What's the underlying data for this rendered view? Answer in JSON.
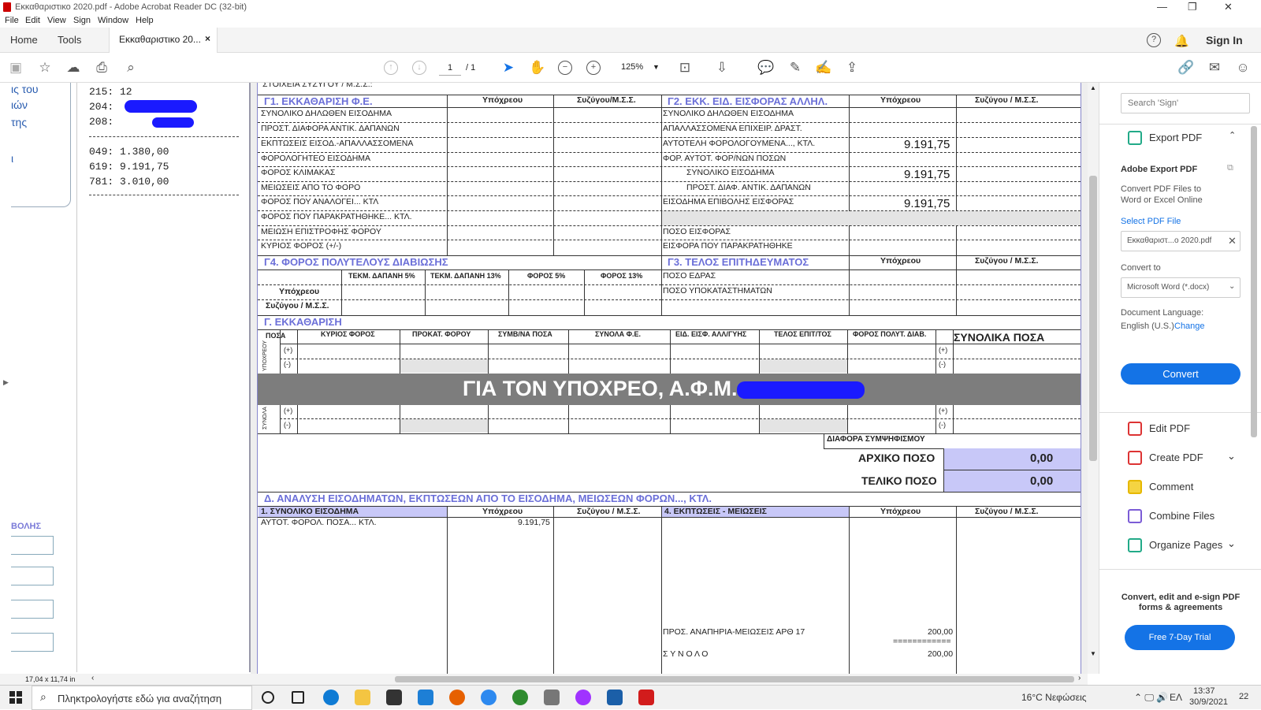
{
  "window": {
    "title": "Εκκαθαριστικο 2020.pdf - Adobe Acrobat Reader DC (32-bit)"
  },
  "menu": [
    "File",
    "Edit",
    "View",
    "Sign",
    "Window",
    "Help"
  ],
  "tabs": {
    "home": "Home",
    "tools": "Tools",
    "doc": "Εκκαθαριστικο 20...",
    "close": "×",
    "signin": "Sign In"
  },
  "toolbar": {
    "page_current": "1",
    "page_total": "/ 1",
    "zoom": "125%"
  },
  "left_panel": {
    "blue_fragments": [
      "ις του",
      "ιών",
      "της",
      "ι",
      "ΒΟΛΗΣ"
    ],
    "lines_top": [
      "215: 12",
      "204:",
      "208:"
    ],
    "lines_bottom": [
      "049:  1.380,00",
      "619:  9.191,75",
      "781:  3.010,00"
    ]
  },
  "doc": {
    "top_fragment": "ΣΤΟΙΧΕΙΑ ΣΥΖΥΓΟΥ / Μ.Σ.Σ.:",
    "g1": {
      "title": "Γ1. ΕΚΚΑΘΑΡΙΣΗ Φ.Ε.",
      "col1": "Υπόχρεου",
      "col2": "Συζύγου/Μ.Σ.Σ.",
      "rows": [
        "ΣΥΝΟΛΙΚΟ ΔΗΛΩΘΕΝ ΕΙΣΟΔΗΜΑ",
        "ΠΡΟΣΤ. ΔΙΑΦΟΡΑ ΑΝΤΙΚ. ΔΑΠΑΝΩΝ",
        "ΕΚΠΤΩΣΕΙΣ ΕΙΣΟΔ.-ΑΠΑΛΛΑΣΣΟΜΕΝΑ",
        "ΦΟΡΟΛΟΓΗΤΕΟ ΕΙΣΟΔΗΜΑ",
        "ΦΟΡΟΣ ΚΛΙΜΑΚΑΣ",
        "ΜΕΙΩΣΕΙΣ ΑΠΟ ΤΟ ΦΟΡΟ",
        "ΦΟΡΟΣ ΠΟΥ ΑΝΑΛΟΓΕΙ... ΚΤΛ",
        "ΦΟΡΟΣ ΠΟΥ ΠΑΡΑΚΡΑΤΗΘΗΚΕ... ΚΤΛ.",
        "ΜΕΙΩΣΗ ΕΠΙΣΤΡΟΦΗΣ ΦΟΡΟΥ",
        "ΚΥΡΙΟΣ ΦΟΡΟΣ (+/-)"
      ]
    },
    "g2": {
      "title": "Γ2. ΕΚΚ. ΕΙΔ.  ΕΙΣΦΟΡΑΣ ΑΛΛΗΛ.",
      "col1": "Υπόχρεου",
      "col2": "Συζύγου / Μ.Σ.Σ.",
      "rows": [
        "ΣΥΝΟΛΙΚΟ ΔΗΛΩΘΕΝ ΕΙΣΟΔΗΜΑ",
        "ΑΠΑΛΛΑΣΣΟΜΕΝΑ ΕΠΙΧΕΙΡ. ΔΡΑΣΤ.",
        "ΑΥΤΟΤΕΛΗ ΦΟΡΟΛΟΓΟΥΜΕΝΑ..., ΚΤΛ.",
        "ΦΟΡ. ΑΥΤΟΤ. ΦΟΡ/ΝΩΝ ΠΟΣΩΝ",
        "ΣΥΝΟΛΙΚΟ ΕΙΣΟΔΗΜΑ",
        "ΠΡΟΣΤ. ΔΙΑΦ. ΑΝΤΙΚ. ΔΑΠΑΝΩΝ",
        "ΕΙΣΟΔΗΜΑ ΕΠΙΒΟΛΗΣ ΕΙΣΦΟΡΑΣ",
        "",
        "ΠΟΣΟ ΕΙΣΦΟΡΑΣ",
        "ΕΙΣΦΟΡΑ ΠΟΥ ΠΑΡΑΚΡΑΤΗΘΗΚΕ"
      ],
      "v1": "9.191,75",
      "v2": "9.191,75",
      "v3": "9.191,75"
    },
    "g4": {
      "title": "Γ4. ΦΟΡΟΣ ΠΟΛΥΤΕΛΟΥΣ ΔΙΑΒΙΩΣΗΣ",
      "c1": "ΤΕΚΜ. ΔΑΠΑΝΗ 5%",
      "c2": "ΤΕΚΜ. ΔΑΠΑΝΗ 13%",
      "c3": "ΦΟΡΟΣ 5%",
      "c4": "ΦΟΡΟΣ 13%",
      "r1": "Υπόχρεου",
      "r2": "Συζύγου / Μ.Σ.Σ."
    },
    "g3": {
      "title": "Γ3. ΤΕΛΟΣ ΕΠΙΤΗΔΕΥΜΑΤΟΣ",
      "col1": "Υπόχρεου",
      "col2": "Συζύγου / Μ.Σ.Σ.",
      "r1": "ΠΟΣΟ ΕΔΡΑΣ",
      "r2": "ΠΟΣΟ ΥΠΟΚΑΤΑΣΤΗΜΑΤΩΝ"
    },
    "g": {
      "title": "Γ. ΕΚΚΑΘΑΡΙΣΗ",
      "cols": [
        "ΠΟΣΑ",
        "ΚΥΡΙΟΣ ΦΟΡΟΣ",
        "ΠΡΟΚΑΤ. ΦΟΡΟΥ",
        "ΣΥΜΒ/ΝΑ ΠΟΣΑ",
        "ΣΥΝΟΛΑ Φ.Ε.",
        "ΕΙΔ. ΕΙΣΦ. ΑΛΛ/ΓΥΗΣ",
        "ΤΕΛΟΣ ΕΠΙΤ/ΤΟΣ",
        "ΦΟΡΟΣ ΠΟΛΥΤ. ΔΙΑΒ."
      ],
      "totals": "ΣΥΝΟΛΙΚΑ ΠΟΣΑ",
      "plus": "(+)",
      "minus": "(-)",
      "side1": "ΥΠΟΧΡΕΟΥ",
      "side2": "ΣΥΝΟΛΑ",
      "banner": "ΓΙΑ ΤΟΝ ΥΠΟΧΡΕΟ, Α.Φ.Μ.",
      "diff": "ΔΙΑΦΟΡΑ ΣΥΜΨΗΦΙΣΜΟΥ",
      "initial": "ΑΡΧΙΚΟ ΠΟΣΟ",
      "initial_val": "0,00",
      "final": "ΤΕΛΙΚΟ ΠΟΣΟ",
      "final_val": "0,00"
    },
    "d": {
      "title": "Δ. ΑΝΑΛΥΣΗ ΕΙΣΟΔΗΜΑΤΩΝ, ΕΚΠΤΩΣΕΩΝ ΑΠΟ ΤΟ ΕΙΣΟΔΗΜΑ, ΜΕΙΩΣΕΩΝ ΦΟΡΩΝ..., ΚΤΛ.",
      "h1": "1. ΣΥΝΟΛΙΚΟ ΕΙΣΟΔΗΜΑ",
      "h1c1": "Υπόχρεου",
      "h1c2": "Συζύγου / Μ.Σ.Σ.",
      "h4": "4. ΕΚΠΤΩΣΕΙΣ - ΜΕΙΩΣΕΙΣ",
      "h4c1": "Υπόχρεου",
      "h4c2": "Συζύγου / Μ.Σ.Σ.",
      "r1": "ΑΥΤΟΤ. ΦΟΡΟΛ. ΠΟΣΑ... ΚΤΛ.",
      "r1v": "9.191,75",
      "r2": "ΠΡΟΣ. ΑΝΑΠΗΡΙΑ-ΜΕΙΩΣΕΙΣ ΑΡΘ 17",
      "r2v": "200,00",
      "sep": "============",
      "r3": "Σ Υ Ν Ο Λ Ο",
      "r3v": "200,00"
    }
  },
  "right_panel": {
    "search_placeholder": "Search 'Sign'",
    "export_head": "Export PDF",
    "adobe_export": "Adobe Export PDF",
    "desc": "Convert PDF Files to Word or Excel Online",
    "select_file": "Select PDF File",
    "file_name": "Εκκαθαριστ...ο 2020.pdf",
    "convert_to": "Convert to",
    "format": "Microsoft Word (*.docx)",
    "doc_lang": "Document Language:",
    "lang": "English (U.S.)",
    "change": "Change",
    "convert_btn": "Convert",
    "tools": [
      "Edit PDF",
      "Create PDF",
      "Comment",
      "Combine Files",
      "Organize Pages"
    ],
    "promo": "Convert, edit and e-sign PDF forms & agreements",
    "trial": "Free 7-Day Trial"
  },
  "status": {
    "size": "17,04 x 11,74 in"
  },
  "taskbar": {
    "search": "Πληκτρολογήστε εδώ για αναζήτηση",
    "weather": "16°C  Νεφώσεις",
    "lang": "ΕΛ",
    "time": "13:37",
    "date": "30/9/2021",
    "notif": "22"
  },
  "colors": {
    "accent": "#1473e6",
    "heading": "#6b6fd8",
    "lavender": "#c8c8f8",
    "banner": "#7d7d7d"
  }
}
